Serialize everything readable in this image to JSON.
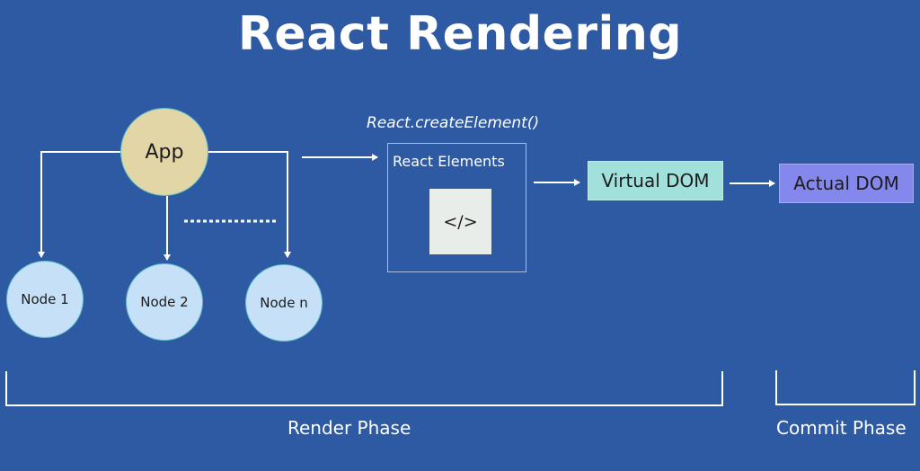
{
  "title": "React Rendering",
  "tree": {
    "root": "App",
    "children": [
      "Node 1",
      "Node 2",
      "Node n"
    ],
    "ellipsis": "dotted"
  },
  "create_element_label": "React.createElement()",
  "react_elements": {
    "label": "React Elements",
    "icon": "</>",
    "icon_name": "code-icon"
  },
  "virtual_dom": "Virtual DOM",
  "actual_dom": "Actual DOM",
  "phases": {
    "render": "Render Phase",
    "commit": "Commit Phase"
  },
  "colors": {
    "background": "#2e5aa3",
    "app_fill": "#e2d6a6",
    "node_fill": "#c6e0f7",
    "virtual_dom_fill": "#a2e0dc",
    "actual_dom_fill": "#8487ec",
    "code_box_fill": "#e8ede9"
  }
}
